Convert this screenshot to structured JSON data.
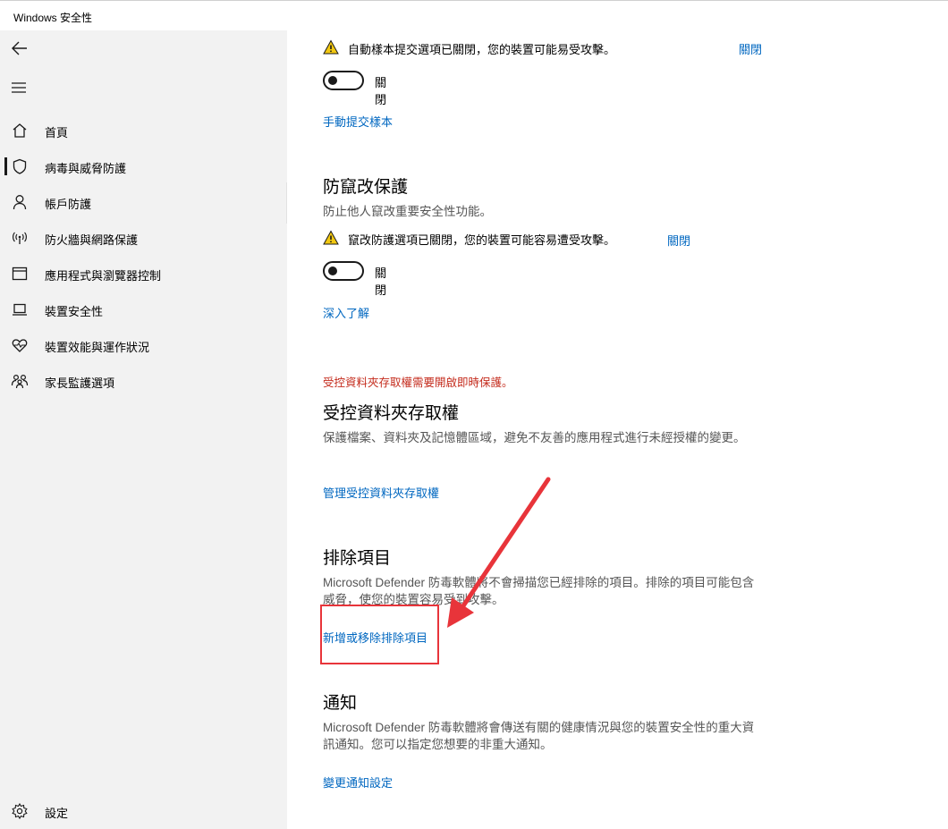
{
  "window": {
    "title": "Windows 安全性"
  },
  "sidebar": {
    "items": [
      {
        "label": "首頁",
        "icon": "home-icon"
      },
      {
        "label": "病毒與威脅防護",
        "icon": "shield-icon",
        "active": true
      },
      {
        "label": "帳戶防護",
        "icon": "person-icon"
      },
      {
        "label": "防火牆與網路保護",
        "icon": "wifi-antenna-icon"
      },
      {
        "label": "應用程式與瀏覽器控制",
        "icon": "browser-window-icon"
      },
      {
        "label": "裝置安全性",
        "icon": "laptop-icon"
      },
      {
        "label": "裝置效能與運作狀況",
        "icon": "heart-pulse-icon"
      },
      {
        "label": "家長監護選項",
        "icon": "family-icon"
      }
    ],
    "settings_label": "設定"
  },
  "sample": {
    "warning": "自動樣本提交選項已關閉，您的裝置可能易受攻擊。",
    "dismiss": "關閉",
    "toggle_label": "關閉",
    "toggle_on": false,
    "manual_link": "手動提交樣本"
  },
  "tamper": {
    "heading": "防竄改保護",
    "desc": "防止他人竄改重要安全性功能。",
    "warning": "竄改防護選項已關閉，您的裝置可能容易遭受攻擊。",
    "dismiss": "關閉",
    "toggle_label": "關閉",
    "toggle_on": false,
    "learn_link": "深入了解"
  },
  "cfa": {
    "note": "受控資料夾存取權需要開啟即時保護。",
    "heading": "受控資料夾存取權",
    "desc": "保護檔案、資料夾及記憶體區域，避免不友善的應用程式進行未經授權的變更。",
    "link": "管理受控資料夾存取權"
  },
  "exclusions": {
    "heading": "排除項目",
    "desc": "Microsoft Defender 防毒軟體將不會掃描您已經排除的項目。排除的項目可能包含威脅，使您的裝置容易受到攻擊。",
    "link": "新增或移除排除項目"
  },
  "notifications": {
    "heading": "通知",
    "desc": "Microsoft Defender 防毒軟體將會傳送有關的健康情況與您的裝置安全性的重大資訊通知。您可以指定您想要的非重大通知。",
    "link": "變更通知設定"
  },
  "colors": {
    "link": "#0067c0",
    "warning_red": "#c42b1c",
    "annotation_red": "#e8343a"
  }
}
